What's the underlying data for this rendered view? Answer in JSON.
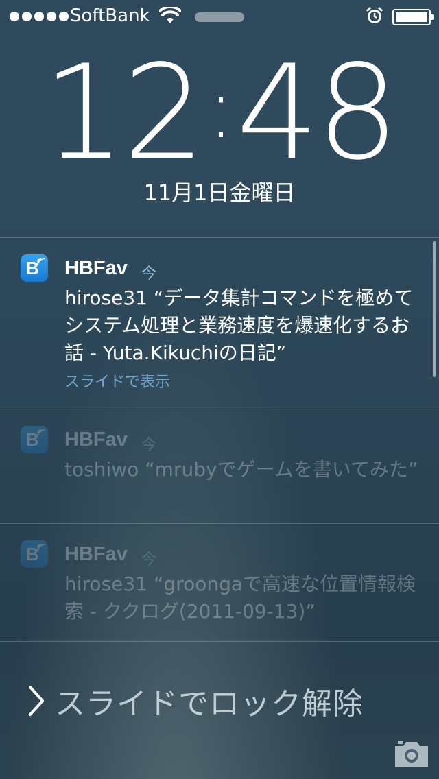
{
  "status_bar": {
    "carrier": "SoftBank",
    "signal_icon": "signal-dots-icon",
    "wifi_icon": "wifi-icon",
    "alarm_icon": "alarm-clock-icon",
    "battery_icon": "battery-icon",
    "battery_level": 1.0
  },
  "lock_screen": {
    "time_hour": "12",
    "time_colon": ":",
    "time_minute": "48",
    "date": "11月1日金曜日"
  },
  "notifications": [
    {
      "app": "HBFav",
      "time": "今",
      "body": "hirose31 “データ集計コマンドを極めてシステム処理と業務速度を爆速化するお話 - Yuta.Kikuchiの日記”",
      "action": "スライドで表示",
      "icon": "hbfav-app-icon"
    },
    {
      "app": "HBFav",
      "time": "今",
      "body": "toshiwo “mrubyでゲームを書いてみた”",
      "icon": "hbfav-app-icon"
    },
    {
      "app": "HBFav",
      "time": "今",
      "body": "hirose31 “groongaで高速な位置情報検索 - ククログ(2011-09-13)”",
      "icon": "hbfav-app-icon"
    }
  ],
  "unlock": {
    "chevron_icon": "chevron-right-icon",
    "text": "スライドでロック解除",
    "camera_icon": "camera-icon"
  },
  "colors": {
    "background": "#2d4759",
    "accent_link": "#6fa6cf",
    "app_icon": "#2a8fe3"
  }
}
